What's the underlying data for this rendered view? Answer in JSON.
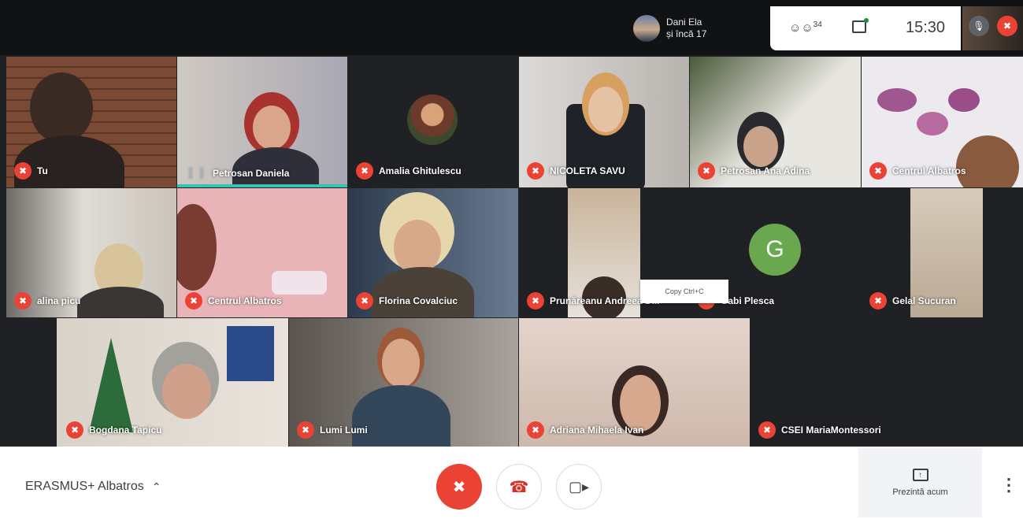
{
  "top": {
    "speaker_name": "Dani Ela",
    "speaker_more": "și încă 17",
    "people_count": "34",
    "clock": "15:30"
  },
  "tooltip": "Copy  Ctrl+C",
  "tiles": [
    {
      "name": "Tu"
    },
    {
      "name": "Petrosan Daniela"
    },
    {
      "name": "Amalia Ghitulescu"
    },
    {
      "name": "NICOLETA SAVU"
    },
    {
      "name": "Petrosan Ana Adina"
    },
    {
      "name": "Centrul Albatros"
    },
    {
      "name": "alina picu"
    },
    {
      "name": "Centrul Albatros"
    },
    {
      "name": "Florina Covalciuc"
    },
    {
      "name": "Prunăreanu Andreea D..."
    },
    {
      "name": "Gabi Plesca",
      "avatar_letter": "G"
    },
    {
      "name": "Gelal Sucuran"
    },
    {
      "name": "Bogdana Tapicu"
    },
    {
      "name": "Lumi Lumi"
    },
    {
      "name": "Adriana Mihaela Ivan"
    },
    {
      "name": "CSEI MariaMontessori"
    }
  ],
  "bottom": {
    "meeting_name": "ERASMUS+ Albatros",
    "present_label": "Prezintă acum"
  },
  "colors": {
    "accent_red": "#ea4335",
    "speaking_bar": "#34c3b5",
    "avatar_green": "#6aa84f"
  }
}
